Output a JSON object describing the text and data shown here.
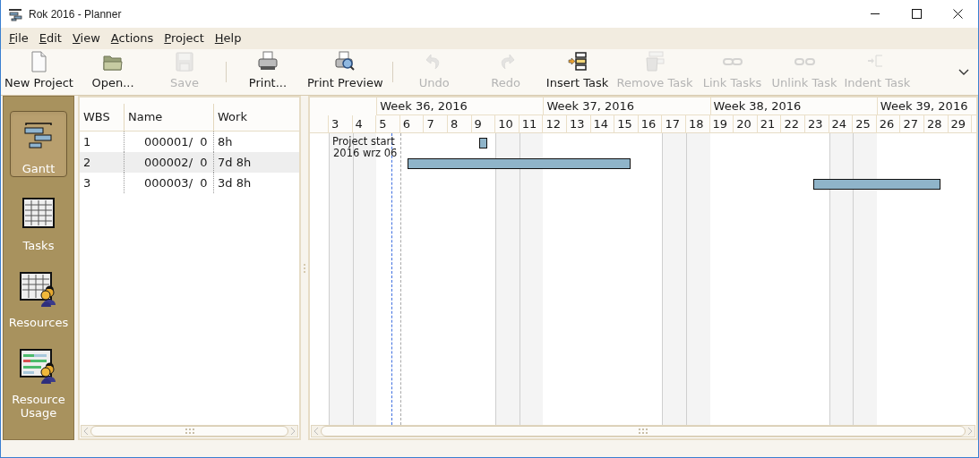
{
  "window": {
    "title": "Rok 2016 - Planner"
  },
  "menu": [
    {
      "label": "File"
    },
    {
      "label": "Edit"
    },
    {
      "label": "View"
    },
    {
      "label": "Actions"
    },
    {
      "label": "Project"
    },
    {
      "label": "Help"
    }
  ],
  "toolbar": [
    {
      "kind": "button",
      "label": "New Project",
      "disabled": false
    },
    {
      "kind": "button",
      "label": "Open...",
      "disabled": false
    },
    {
      "kind": "button",
      "label": "Save",
      "disabled": true
    },
    {
      "kind": "separator"
    },
    {
      "kind": "button",
      "label": "Print...",
      "disabled": false
    },
    {
      "kind": "button",
      "label": "Print Preview",
      "disabled": false
    },
    {
      "kind": "separator"
    },
    {
      "kind": "button",
      "label": "Undo",
      "disabled": true
    },
    {
      "kind": "button",
      "label": "Redo",
      "disabled": true
    },
    {
      "kind": "button",
      "label": "Insert Task",
      "disabled": false
    },
    {
      "kind": "button",
      "label": "Remove Task",
      "disabled": true
    },
    {
      "kind": "button",
      "label": "Link Tasks",
      "disabled": true
    },
    {
      "kind": "button",
      "label": "Unlink Task",
      "disabled": true
    },
    {
      "kind": "button",
      "label": "Indent Task",
      "disabled": true
    }
  ],
  "sidebar": {
    "items": [
      {
        "label": "Gantt",
        "selected": true
      },
      {
        "label": "Tasks",
        "selected": false
      },
      {
        "label": "Resources",
        "selected": false
      },
      {
        "label": "Resource Usage",
        "selected": false
      }
    ]
  },
  "table": {
    "columns": [
      "WBS",
      "Name",
      "Work"
    ],
    "rows": [
      {
        "wbs": "1",
        "name": "000001/  0",
        "work": "8h",
        "selected": false
      },
      {
        "wbs": "2",
        "name": "000002/  0",
        "work": "7d 8h",
        "selected": true
      },
      {
        "wbs": "3",
        "name": "000003/  0",
        "work": "3d 8h",
        "selected": false
      }
    ]
  },
  "gantt": {
    "weeks": [
      "Week 36, 2016",
      "Week 37, 2016",
      "Week 38, 2016",
      "Week 39, 2016"
    ],
    "days": [
      {
        "label": "3",
        "weekend": true
      },
      {
        "label": "4",
        "weekend": true
      },
      {
        "label": "5",
        "weekend": false
      },
      {
        "label": "6",
        "weekend": false
      },
      {
        "label": "7",
        "weekend": false
      },
      {
        "label": "8",
        "weekend": false
      },
      {
        "label": "9",
        "weekend": false
      },
      {
        "label": "10",
        "weekend": true
      },
      {
        "label": "11",
        "weekend": true
      },
      {
        "label": "12",
        "weekend": false
      },
      {
        "label": "13",
        "weekend": false
      },
      {
        "label": "14",
        "weekend": false
      },
      {
        "label": "15",
        "weekend": false
      },
      {
        "label": "16",
        "weekend": false
      },
      {
        "label": "17",
        "weekend": true
      },
      {
        "label": "18",
        "weekend": true
      },
      {
        "label": "19",
        "weekend": false
      },
      {
        "label": "20",
        "weekend": false
      },
      {
        "label": "21",
        "weekend": false
      },
      {
        "label": "22",
        "weekend": false
      },
      {
        "label": "23",
        "weekend": false
      },
      {
        "label": "24",
        "weekend": true
      },
      {
        "label": "25",
        "weekend": true
      },
      {
        "label": "26",
        "weekend": false
      },
      {
        "label": "27",
        "weekend": false
      },
      {
        "label": "28",
        "weekend": false
      },
      {
        "label": "29",
        "weekend": false
      }
    ],
    "project_start": {
      "label": "Project start",
      "date": "2016 wrz 06"
    }
  }
}
